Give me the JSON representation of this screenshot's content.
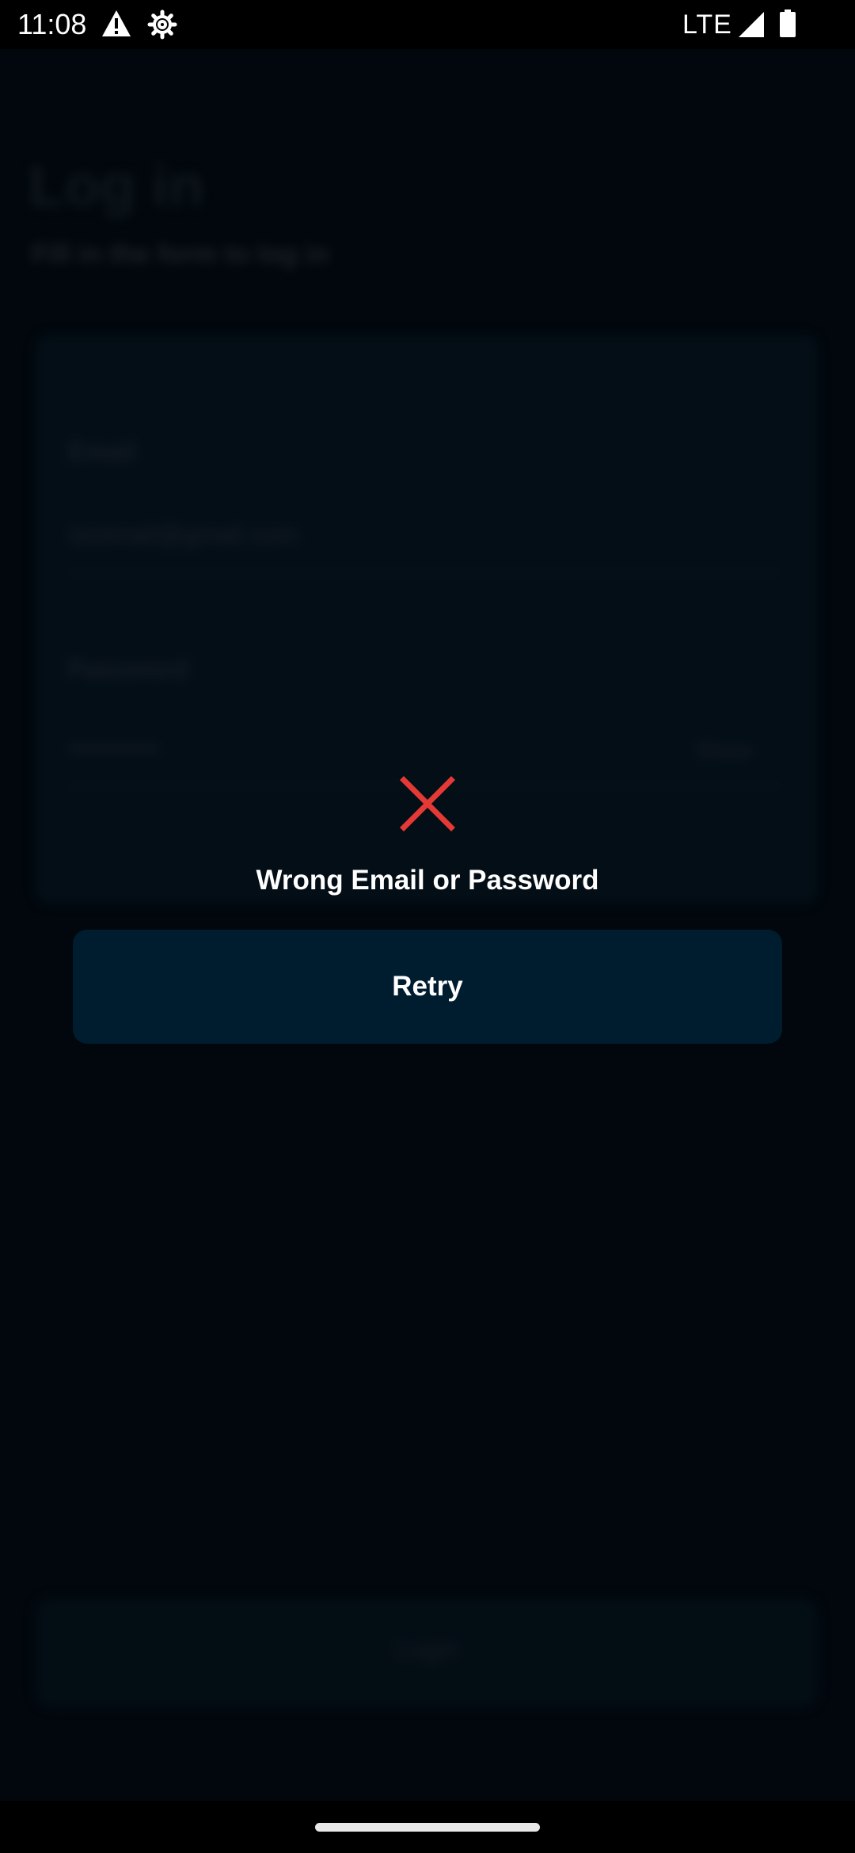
{
  "status_bar": {
    "time": "11:08",
    "network": "LTE",
    "icons": [
      "warning-icon",
      "settings-gear-icon",
      "signal-icon",
      "battery-icon"
    ]
  },
  "background_form": {
    "title": "Log in",
    "subtitle": "Fill in the form to log in",
    "email_label": "Email",
    "email_value": "testmail@gmail.com",
    "password_label": "Password",
    "password_value": "••••••••••",
    "show_label": "Show",
    "login_button_label": "Login"
  },
  "dialog": {
    "icon": "close-x-icon",
    "message": "Wrong Email or Password",
    "retry_label": "Retry"
  },
  "colors": {
    "error_red": "#e53935",
    "button_bg": "#001d30",
    "screen_bg": "#02080f"
  }
}
